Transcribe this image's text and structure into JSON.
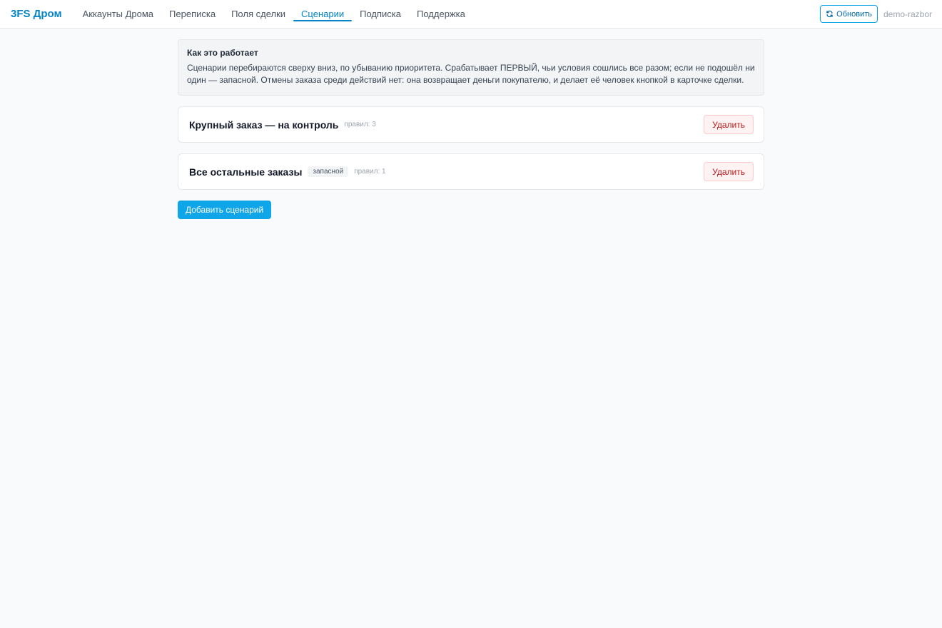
{
  "header": {
    "brand": "3FS Дром",
    "nav": [
      {
        "label": "Аккаунты Дрома"
      },
      {
        "label": "Переписка"
      },
      {
        "label": "Поля сделки"
      },
      {
        "label": "Сценарии",
        "active": true
      },
      {
        "label": "Подписка"
      },
      {
        "label": "Поддержка"
      }
    ],
    "refresh_label": "Обновить",
    "account": "demo-razbor"
  },
  "info": {
    "title": "Как это работает",
    "text": "Сценарии перебираются сверху вниз, по убыванию приоритета. Срабатывает ПЕРВЫЙ, чьи условия сошлись все разом; если не подошёл ни один — запасной. Отмены заказа среди действий нет: она возвращает деньги покупателю, и делает её человек кнопкой в карточке сделки."
  },
  "scenarios": [
    {
      "title": "Крупный заказ — на контроль",
      "rules": "правил: 3",
      "delete_label": "Удалить"
    },
    {
      "title": "Все остальные заказы",
      "badge": "запасной",
      "rules": "правил: 1",
      "delete_label": "Удалить"
    }
  ],
  "add_label": "Добавить сценарий",
  "colors": {
    "accent": "#0284c7",
    "button_primary": "#0ea5e9",
    "danger_text": "#b91c1c",
    "danger_bg": "#fef2f2",
    "page_bg": "#f8fafc"
  },
  "icons": {
    "refresh": "refresh-icon"
  }
}
